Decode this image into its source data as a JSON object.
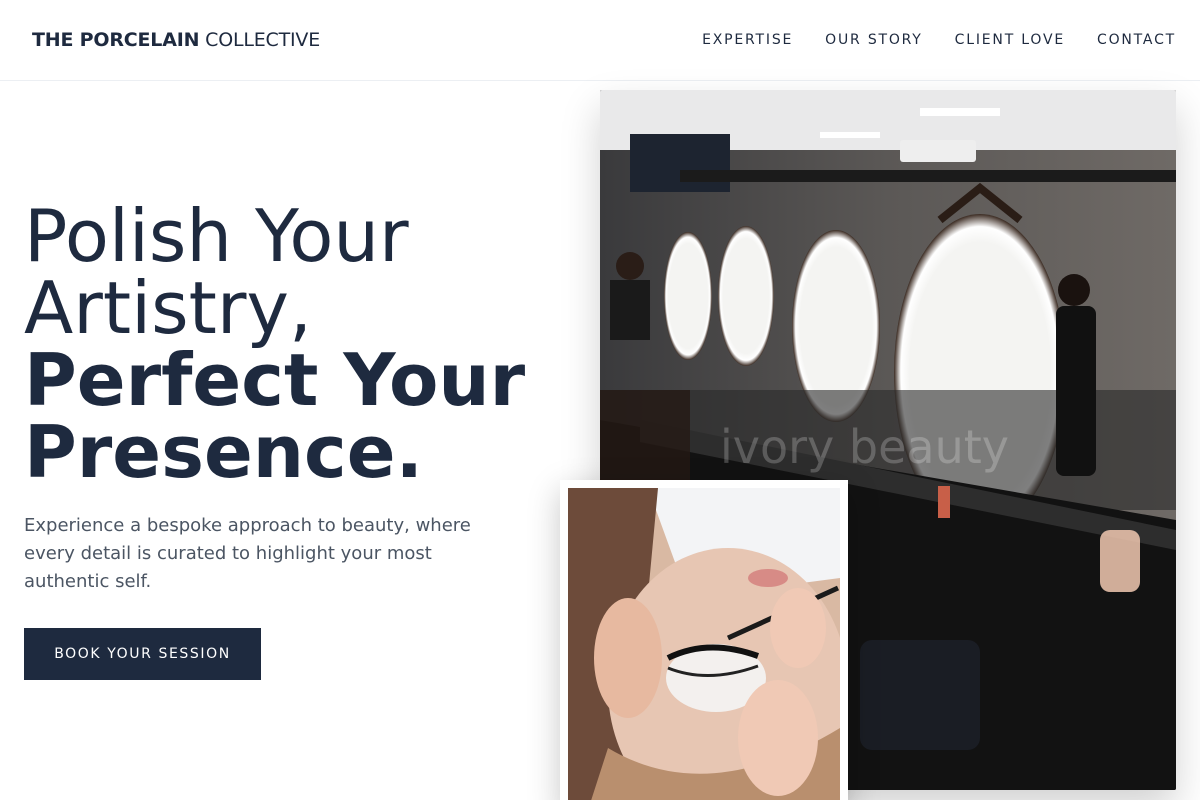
{
  "header": {
    "logo_bold": "THE PORCELAIN",
    "logo_light": "COLLECTIVE",
    "nav": [
      {
        "label": "EXPERTISE"
      },
      {
        "label": "OUR STORY"
      },
      {
        "label": "CLIENT LOVE"
      },
      {
        "label": "CONTACT"
      }
    ]
  },
  "hero": {
    "title_line1": "Polish Your",
    "title_line2": "Artistry,",
    "title_line3": "Perfect Your",
    "title_line4": "Presence.",
    "description": "Experience a bespoke approach to beauty, where every detail is curated to highlight your most authentic self.",
    "cta_label": "BOOK YOUR SESSION"
  },
  "images": {
    "watermark": "ivory beauty",
    "main_photo": "salon-interior-with-lit-mirrors",
    "secondary_photo": "lash-extension-application"
  },
  "colors": {
    "primary": "#1e2a3f",
    "text_secondary": "#4b5563",
    "background": "#ffffff"
  }
}
